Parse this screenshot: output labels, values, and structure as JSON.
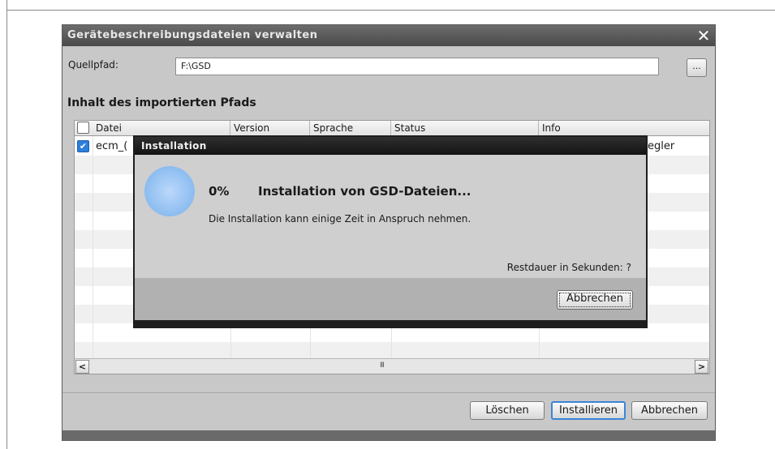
{
  "dialog": {
    "title": "Gerätebeschreibungsdateien verwalten",
    "close_glyph": "✕"
  },
  "source": {
    "label": "Quellpfad:",
    "value": "F:\\GSD",
    "browse_label": "..."
  },
  "section_title": "Inhalt des importierten Pfads",
  "table": {
    "columns": [
      "Datei",
      "Version",
      "Sprache",
      "Status",
      "Info"
    ],
    "rows": [
      {
        "checked": true,
        "file": "ecm_(",
        "info": "egler"
      }
    ],
    "scroll_left": "<",
    "scroll_right": ">",
    "scroll_grip": "III"
  },
  "buttons": {
    "delete": "Löschen",
    "install": "Installieren",
    "cancel": "Abbrechen"
  },
  "popup": {
    "title": "Installation",
    "percent": "0%",
    "heading": "Installation von GSD-Dateien...",
    "note": "Die Installation kann einige Zeit in Anspruch nehmen.",
    "remaining": "Restdauer in Sekunden: ?",
    "cancel": "Abbrechen",
    "progress_fraction": 0
  },
  "icons": {
    "checkmark": "✔",
    "spinner": "progress-spinner-icon"
  },
  "colors": {
    "accent": "#3b84d6",
    "checkbox_checked": "#2d7fd9",
    "titlebar": "#4a4a4a",
    "popup_titlebar": "#141414"
  }
}
